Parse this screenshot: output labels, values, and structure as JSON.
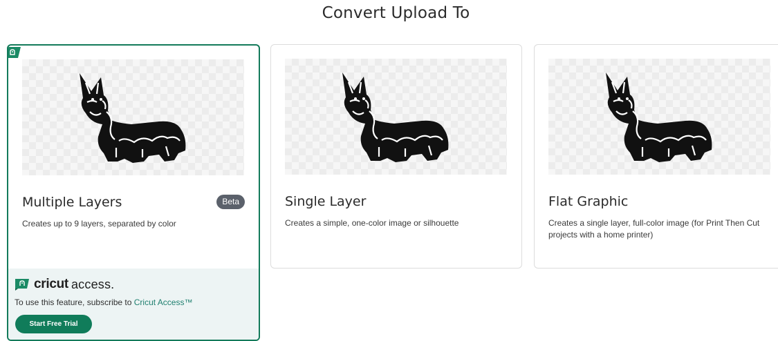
{
  "page": {
    "title": "Convert Upload To"
  },
  "cards": [
    {
      "title": "Multiple Layers",
      "badge": "Beta",
      "description": "Creates up to 9 layers, separated by color",
      "selected": true
    },
    {
      "title": "Single Layer",
      "description": "Creates a simple, one-color image or silhouette"
    },
    {
      "title": "Flat Graphic",
      "description": "Creates a single layer, full-color image (for Print Then Cut projects with a home printer)"
    }
  ],
  "access": {
    "brand_cricut": "cricut",
    "brand_access": "access.",
    "text_prefix": "To use this feature, subscribe to ",
    "link_text": "Cricut Access™",
    "button_label": "Start Free Trial",
    "icon": "cricut-access-icon"
  },
  "colors": {
    "accent": "#107c5a",
    "selected_border": "#137a5a",
    "access_bg": "#edf4f4",
    "badge_bg": "#5b616b",
    "link": "#1f7f6f"
  }
}
